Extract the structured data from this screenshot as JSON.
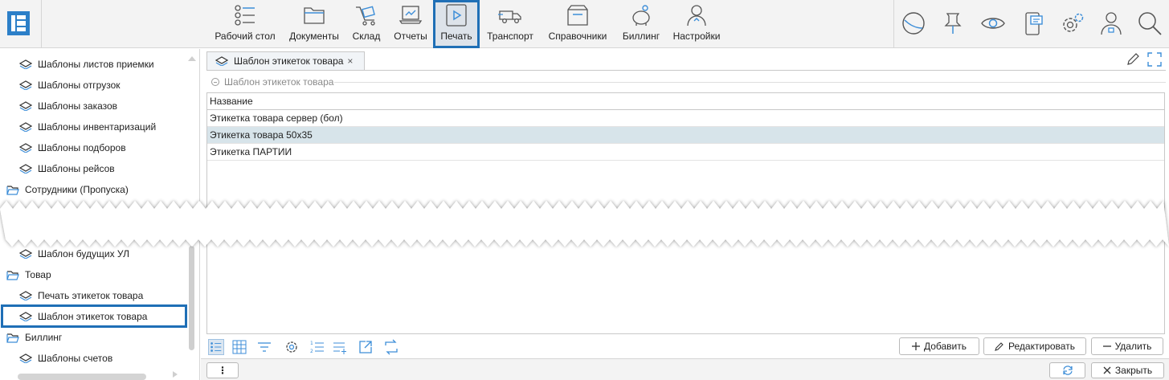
{
  "nav": {
    "items": [
      {
        "label": "Рабочий стол",
        "icon": "list-icon"
      },
      {
        "label": "Документы",
        "icon": "folder-icon"
      },
      {
        "label": "Склад",
        "icon": "cart-icon"
      },
      {
        "label": "Отчеты",
        "icon": "report-icon"
      },
      {
        "label": "Печать",
        "icon": "play-icon"
      },
      {
        "label": "Транспорт",
        "icon": "truck-icon"
      },
      {
        "label": "Справочники",
        "icon": "box-icon"
      },
      {
        "label": "Биллинг",
        "icon": "piggy-bank-icon"
      },
      {
        "label": "Настройки",
        "icon": "user-settings-icon"
      }
    ],
    "active": "Печать"
  },
  "sidebar": {
    "items_top": [
      "Шаблоны листов приемки",
      "Шаблоны отгрузок",
      "Шаблоны заказов",
      "Шаблоны инвентаризаций",
      "Шаблоны подборов",
      "Шаблоны рейсов"
    ],
    "folder_employees": "Сотрудники (Пропуска)",
    "item_future": "Шаблон будущих УЛ",
    "folder_goods": "Товар",
    "item_print_labels": "Печать этикеток товара",
    "item_label_template": "Шаблон этикеток товара",
    "folder_billing": "Биллинг",
    "item_invoices": "Шаблоны счетов"
  },
  "tab": {
    "label": "Шаблон этикеток товара",
    "close": "×"
  },
  "group": {
    "title": "Шаблон этикеток товара"
  },
  "grid": {
    "column": "Название",
    "rows": [
      "Этикетка товара сервер (бол)",
      "Этикетка товара 50х35",
      "Этикетка ПАРТИИ"
    ],
    "selected_index": 1
  },
  "actions": {
    "add": "Добавить",
    "edit": "Редактировать",
    "delete": "Удалить"
  },
  "footer": {
    "more": "⋮",
    "close": "Закрыть"
  },
  "colors": {
    "accent": "#1f6fb6",
    "icon_blue": "#3d8ed8",
    "selected_row": "#d7e4ea"
  }
}
